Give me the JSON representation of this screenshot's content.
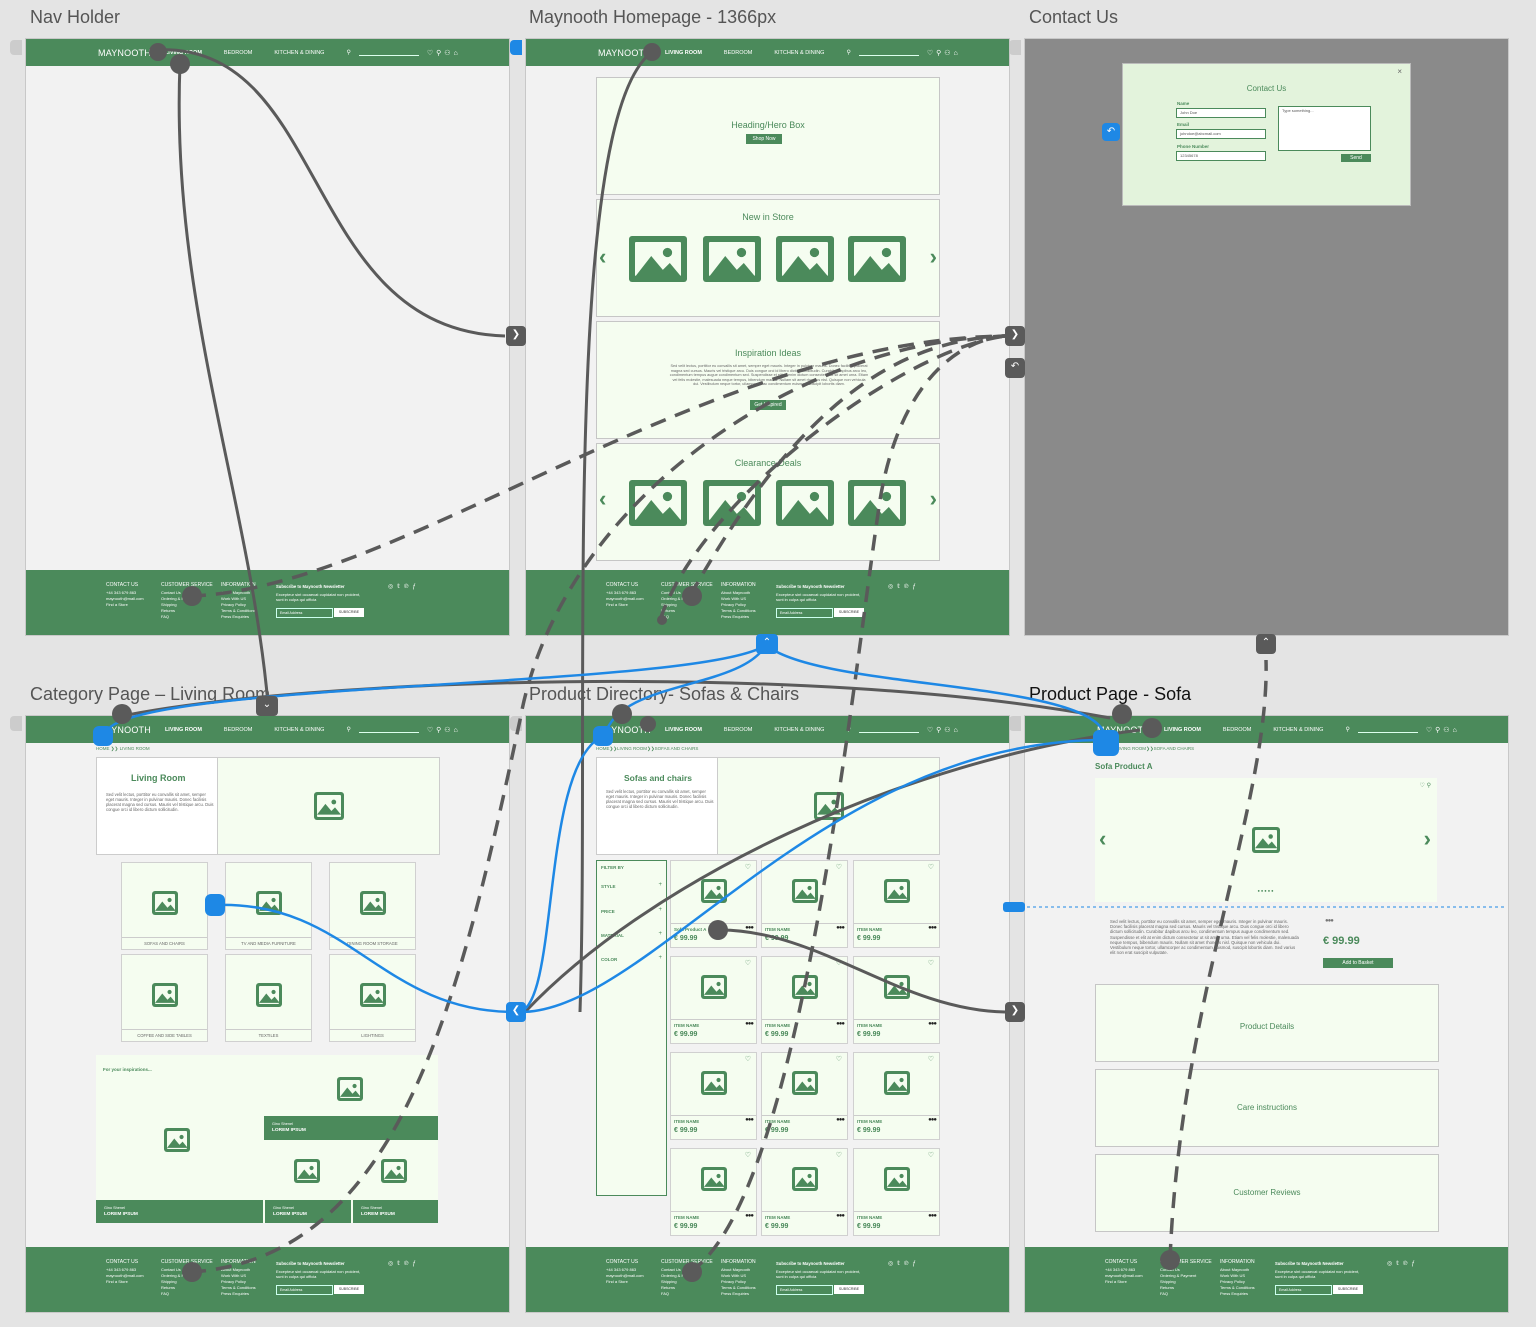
{
  "boards": {
    "nav_holder": "Nav Holder",
    "homepage": "Maynooth Homepage - 1366px",
    "contact": "Contact Us",
    "category": "Category Page – Living Room",
    "directory": "Product Directory- Sofas & Chairs",
    "product": "Product Page - Sofa"
  },
  "nav": {
    "brand": "MAYNOOTH",
    "links": [
      "LIVING ROOM",
      "BEDROOM",
      "KITCHEN & DINING"
    ],
    "icons": [
      "search-icon",
      "heart-icon",
      "location-icon",
      "user-icon",
      "basket-icon"
    ]
  },
  "footer": {
    "contact_heading": "CONTACT US",
    "contact_lines": [
      "+44 343 679 863",
      "maynooth@mail.com",
      "Find a Store"
    ],
    "service_heading": "CUSTOMER SERVICE",
    "service_lines": [
      "Contact Us",
      "Ordering & Payment",
      "Shipping",
      "Returns",
      "FAQ"
    ],
    "info_heading": "INFORMATION",
    "info_lines": [
      "About Maynooth",
      "Work With US",
      "Privacy Policy",
      "Terms & Conditions",
      "Press Enquiries"
    ],
    "newsletter_heading": "Subscribe to Maynooth Newsletter",
    "newsletter_text": "Excepteur sint occaecat cupidatat non proident, sunt in culpa qui officia",
    "email_placeholder": "Email Address",
    "subscribe": "SUBSCRIBE",
    "social_icons": [
      "instagram-icon",
      "twitter-icon",
      "pinterest-icon",
      "facebook-icon"
    ]
  },
  "home": {
    "hero_title": "Heading/Hero Box",
    "shop_now": "Shop Now",
    "new_in_store": "New in Store",
    "inspiration_title": "Inspiration Ideas",
    "inspiration_text": "Sed velit lectus, porttitor eu convallis sit amet, semper eget mauris. Integer in pulvinar mauris. Donec facilisis placerat magna sed cursus. Mauris vel tristique arcu. Duis congue orci id libero dictum sollicitudin. Curabitur dapibus arcu leo, condimentum tempus augue condimentum sed. Suspendisse et elit at enim dictum consectetur ut sit amet urna. Etiam vel felis molestie, malesuada neque tempus, bibendum mauris. Nullam sit amet rhoncus nisl. Quisque non vehicula dui. Vestibulum neque tortor, ullamcorper ac condimentum euismod, suscipit lobortis diam.",
    "get_inspired": "Get Inspired",
    "clearance": "Clearance Deals"
  },
  "contact": {
    "title": "Contact Us",
    "close": "×",
    "name_label": "Name",
    "name_value": "John Doe",
    "email_label": "Email",
    "email_value": "johndoe@abcmail.com",
    "phone_label": "Phone Number",
    "phone_value": "12345678",
    "message_placeholder": "Type something...",
    "send": "Send"
  },
  "category": {
    "breadcrumb_home": "HOME",
    "breadcrumb_sep": "❯❯",
    "breadcrumb_current": "LIVING ROOM",
    "title": "Living Room",
    "description": "Sed velit lectus, porttitor eu convallis sit amet, semper eget mauris. Integer in pulvinar mauris. Donec facilisis placerat magna sed cursus. Mauris vel tristique arcu. Duis congue orci id libero dictum sollicitudin.",
    "tiles": [
      "SOFAS AND CHAIRS",
      "TV AND MEDIA FURNITURE",
      "DINING ROOM STORAGE",
      "COFFEE AND SIDE TABLES",
      "TEXTILES",
      "LIGHTINGS"
    ],
    "inspiration_heading": "For your inspirations...",
    "banner_small": "Gino Shenel",
    "banner_big": "LOREM IPSUM"
  },
  "directory": {
    "breadcrumb_home": "HOME",
    "breadcrumb_mid": "LIVING ROOM",
    "breadcrumb_current": "SOFAS AND CHAIRS",
    "title": "Sofas and chairs",
    "description": "Sed velit lectus, porttitor eu convallis sit amet, semper eget mauris. Integer in pulvinar mauris. Donec facilisis placerat magna sed cursus. Mauris vel tristique arcu. Duis congue orci id libero dictum sollicitudin.",
    "filter_by": "FILTER BY",
    "filters": [
      "STYLE",
      "PRICE",
      "MATERIAL",
      "COLOR"
    ],
    "plus": "+",
    "first_item": "Sofa Product A",
    "item_name": "ITEM NAME",
    "price": "€ 99.99",
    "heart": "♡",
    "swatches": "●●●"
  },
  "product": {
    "breadcrumb_home": "HOME",
    "breadcrumb_mid": "LIVING ROOM",
    "breadcrumb_current": "SOFA AND CHAIRS",
    "title": "Sofa Product A",
    "gallery_dots": "●●●●●",
    "gallery_icons": "♡ ⚲",
    "description": "Sed velit lectus, porttitor eu convallis sit amet, semper eget mauris. Integer in pulvinar mauris. Donec facilisis placerat magna sed cursus. Mauris vel tristique arcu. Duis congue orci id libero dictum sollicitudin. Curabitur dapibus arcu leo, condimentum tempus augue condimentum sed. Suspendisse et elit at enim dictum consectetur ut sit amet urna. Etiam vel felis molestie, malesuada neque tempus, bibendum mauris. Nullam sit amet rhoncus nisl. Quisque non vehicula dui. Vestibulum neque tortor, ullamcorper ac condimentum euismod, suscipit lobortis diam. Sed varius elit non erat suscipit vulputate.",
    "swatches": "●●●",
    "price": "€ 99.99",
    "add_to_basket": "Add to Basket",
    "accordions": [
      "Product Details",
      "Care instructions",
      "Customer Reviews"
    ]
  },
  "colors": {
    "brand_green": "#4b8a5b",
    "panel_bg": "#f5fdf0",
    "wire_grey": "#5a5a5a",
    "wire_blue": "#1e88e5"
  }
}
